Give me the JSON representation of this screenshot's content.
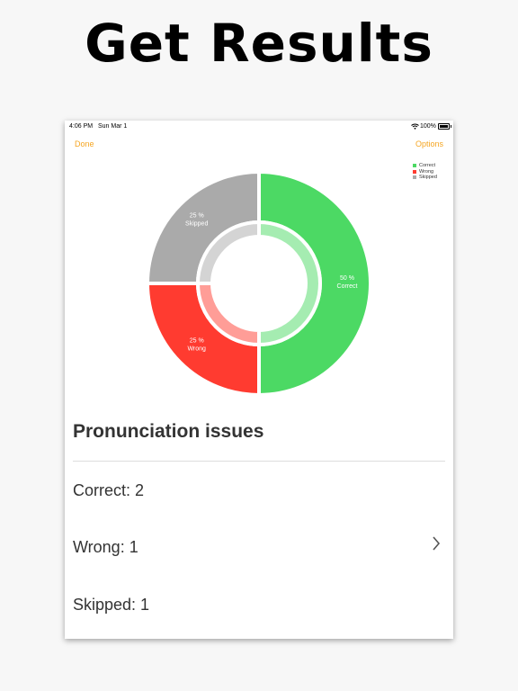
{
  "headline": "Get Results",
  "status_bar": {
    "time": "4:06 PM",
    "date": "Sun Mar 1",
    "battery": "100%"
  },
  "nav": {
    "done_label": "Done",
    "options_label": "Options"
  },
  "chart_data": {
    "type": "pie",
    "categories": [
      "Correct",
      "Wrong",
      "Skipped"
    ],
    "values": [
      50,
      25,
      25
    ],
    "slice_labels": [
      {
        "pct": "50 %",
        "name": "Correct"
      },
      {
        "pct": "25 %",
        "name": "Wrong"
      },
      {
        "pct": "25 %",
        "name": "Skipped"
      }
    ],
    "colors": [
      "#4cd964",
      "#ff3b30",
      "#aaaaaa"
    ],
    "legend": [
      "Correct",
      "Wrong",
      "Skipped"
    ],
    "legend_position": "top-right",
    "style": "donut"
  },
  "section_title": "Pronunciation issues",
  "results": [
    {
      "label": "Correct: 2"
    },
    {
      "label": "Wrong: 1",
      "chevron": "chevron-right-icon"
    },
    {
      "label": "Skipped: 1"
    }
  ],
  "icons": {
    "wifi": "wifi-icon",
    "battery": "battery-icon",
    "chevron": "chevron-right-icon"
  }
}
